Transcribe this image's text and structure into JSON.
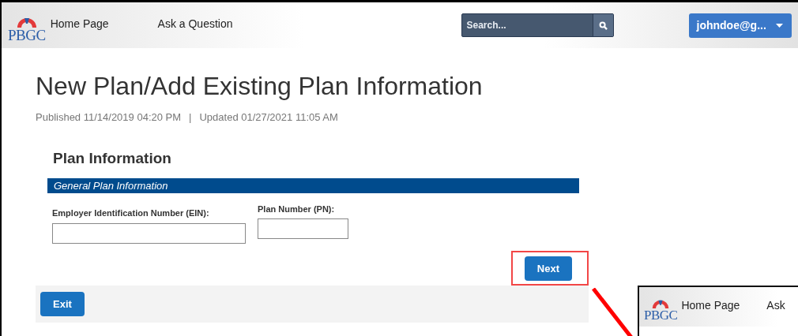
{
  "header": {
    "logo": "PBGC",
    "nav": [
      {
        "label": "Home Page"
      },
      {
        "label": "Ask a Question"
      }
    ],
    "search": {
      "placeholder": "Search..."
    },
    "user_menu": {
      "label": "johndoe@g..."
    }
  },
  "page": {
    "title": "New Plan/Add Existing Plan Information",
    "published": "Published 11/14/2019 04:20 PM",
    "separator": "|",
    "updated": "Updated 01/27/2021 11:05 AM"
  },
  "form": {
    "heading": "Plan Information",
    "section": "General Plan Information",
    "fields": [
      {
        "label": "Employer Identification Number (EIN):"
      },
      {
        "label": "Plan Number (PN):"
      }
    ],
    "next": {
      "label": "Next",
      "highlighted": true
    },
    "exit": {
      "label": "Exit"
    }
  },
  "inset": {
    "logo": "PBGC",
    "nav": [
      {
        "label": "Home Page"
      },
      {
        "label": "Ask"
      }
    ]
  }
}
